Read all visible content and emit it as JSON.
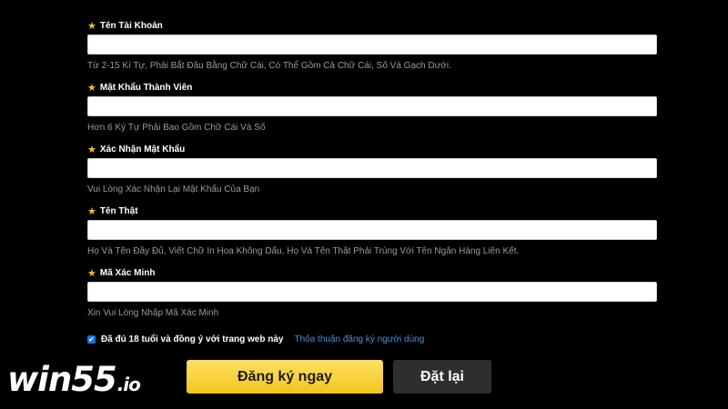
{
  "form": {
    "fields": [
      {
        "label": "Tên Tài Khoản",
        "value": "",
        "hint": "Từ 2-15 Kí Tự, Phải Bắt Đầu Bằng Chữ Cái, Có Thể Gồm Cả Chữ Cái, Số Và Gạch Dưới."
      },
      {
        "label": "Mật Khẩu Thành Viên",
        "value": "",
        "hint": "Hơn 6 Ký Tự Phải Bao Gồm Chữ Cái Và Số"
      },
      {
        "label": "Xác Nhận Mật Khẩu",
        "value": "",
        "hint": "Vui Lòng Xác Nhận Lại Mật Khẩu Của Bạn"
      },
      {
        "label": "Tên Thật",
        "value": "",
        "hint": "Họ Và Tên Đầy Đủ, Viết Chữ In Hoa Không Dấu, Họ Và Tên Thật Phải Trùng Với Tên Ngân Hàng Liên Kết."
      },
      {
        "label": "Mã Xác Minh",
        "value": "",
        "hint": "Xin Vui Lòng Nhập Mã Xác Minh"
      }
    ],
    "agree_text": "Đã đủ 18 tuổi và đồng ý với trang web này",
    "agree_checked": true,
    "terms_link": "Thỏa thuận đăng ký người dùng",
    "register_button": "Đăng ký ngay",
    "reset_button": "Đặt lại"
  },
  "logo": {
    "main": "win55",
    "tld": ".io"
  },
  "icons": {
    "field_label_icon": "star-icon",
    "agree_checkbox_icon": "checkmark-icon"
  },
  "colors": {
    "accent": "#f3c51a",
    "background": "#000000",
    "link": "#4d8fd6",
    "checkbox": "#1a73e8",
    "reset_button": "#2e2e2e"
  }
}
